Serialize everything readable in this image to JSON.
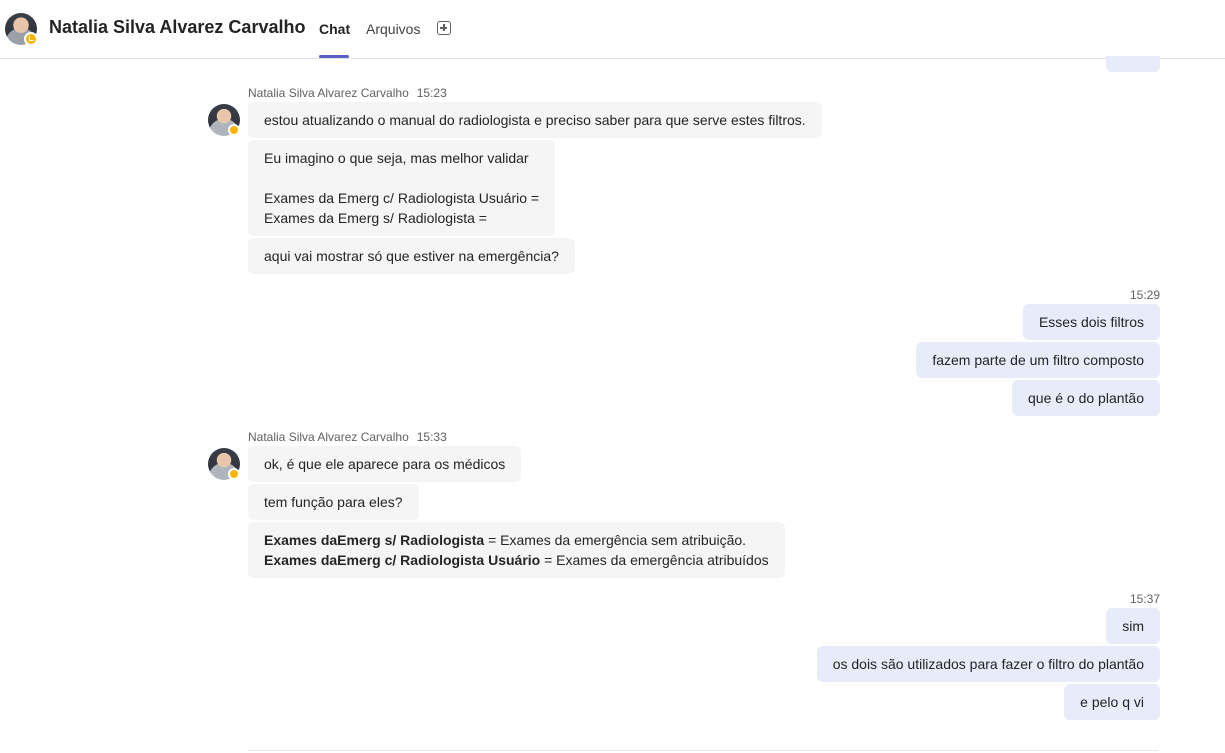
{
  "header": {
    "contact_name": "Natalia Silva Alvarez Carvalho",
    "tabs": [
      {
        "label": "Chat",
        "active": true
      },
      {
        "label": "Arquivos",
        "active": false
      }
    ],
    "add_tab_icon": "plus-square-icon",
    "presence_status_color": "#f8b400"
  },
  "messages": {
    "group1": {
      "sender": "Natalia Silva Alvarez Carvalho",
      "time": "15:23",
      "bubbles": [
        "estou atualizando o manual do radiologista e preciso saber para que serve estes filtros.",
        "Eu imagino o que seja, mas melhor validar",
        "Exames da Emerg c/ Radiologista Usuário =",
        "Exames da Emerg s/ Radiologista =",
        "aqui vai mostrar só que estiver na emergência?"
      ]
    },
    "group2": {
      "time": "15:29",
      "bubbles": [
        "Esses dois filtros",
        "fazem parte de um filtro composto",
        "que é o do plantão"
      ]
    },
    "group3": {
      "sender": "Natalia Silva Alvarez Carvalho",
      "time": "15:33",
      "bubbles": [
        "ok, é que ele aparece para os médicos",
        "tem função para eles?"
      ],
      "definition1_bold": "Exames daEmerg s/ Radiologista",
      "definition1_text": " = Exames da emergência sem atribuição.",
      "definition2_bold": "Exames daEmerg c/ Radiologista Usuário",
      "definition2_text": " = Exames da emergência atribuídos"
    },
    "group4": {
      "time": "15:37",
      "bubbles": [
        "sim",
        "os dois são utilizados para fazer o filtro do plantão",
        "e pelo q vi"
      ]
    }
  },
  "colors": {
    "accent": "#5b5fc7",
    "incoming_bubble": "#f5f5f5",
    "outgoing_bubble": "#e8ebfa"
  }
}
